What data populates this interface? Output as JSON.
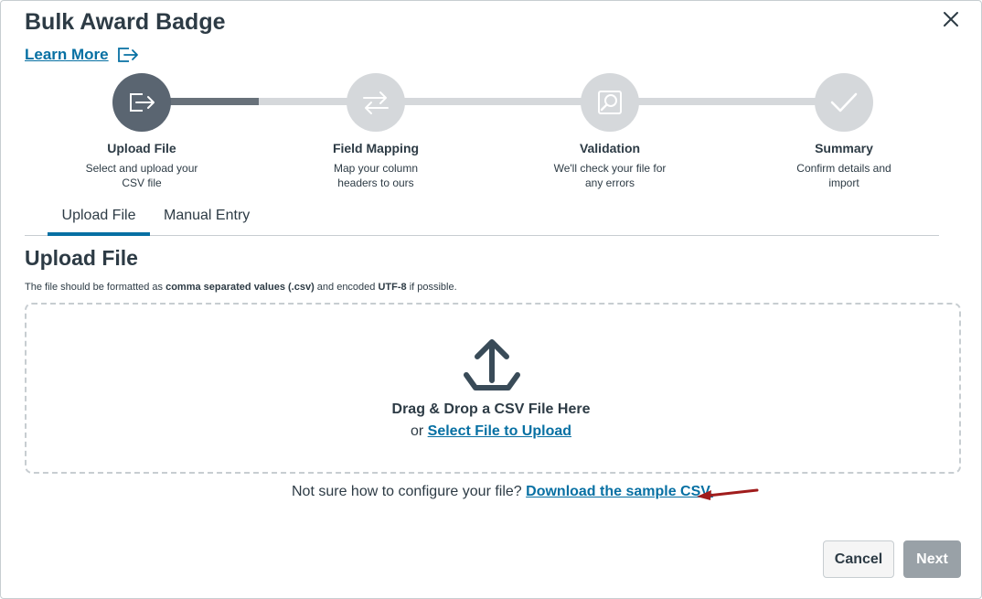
{
  "dialog": {
    "title": "Bulk Award Badge",
    "learn_more": "Learn More"
  },
  "steps": [
    {
      "label": "Upload File",
      "desc_line1": "Select and upload your",
      "desc_line2": "CSV file",
      "state": "active"
    },
    {
      "label": "Field Mapping",
      "desc_line1": "Map your column",
      "desc_line2": "headers to ours",
      "state": "upcoming"
    },
    {
      "label": "Validation",
      "desc_line1": "We'll check your file for",
      "desc_line2": "any errors",
      "state": "upcoming"
    },
    {
      "label": "Summary",
      "desc_line1": "Confirm details and",
      "desc_line2": "import",
      "state": "upcoming"
    }
  ],
  "tabs": [
    {
      "label": "Upload File",
      "active": true
    },
    {
      "label": "Manual Entry",
      "active": false
    }
  ],
  "upload": {
    "heading": "Upload File",
    "hint_pre": "The file should be formatted as ",
    "hint_b1": "comma separated values (.csv)",
    "hint_mid": " and encoded ",
    "hint_b2": "UTF-8",
    "hint_post": " if possible.",
    "drop_title": "Drag & Drop a CSV File Here",
    "drop_or": "or ",
    "select_link": "Select File to Upload",
    "sample_prompt": "Not sure how to configure your file? ",
    "sample_link": "Download the sample CSV."
  },
  "footer": {
    "cancel": "Cancel",
    "next": "Next"
  },
  "colors": {
    "link": "#0770a3",
    "active_step": "#5a6571",
    "inactive_step": "#d5d8db",
    "annotation_arrow": "#a01c1c"
  }
}
